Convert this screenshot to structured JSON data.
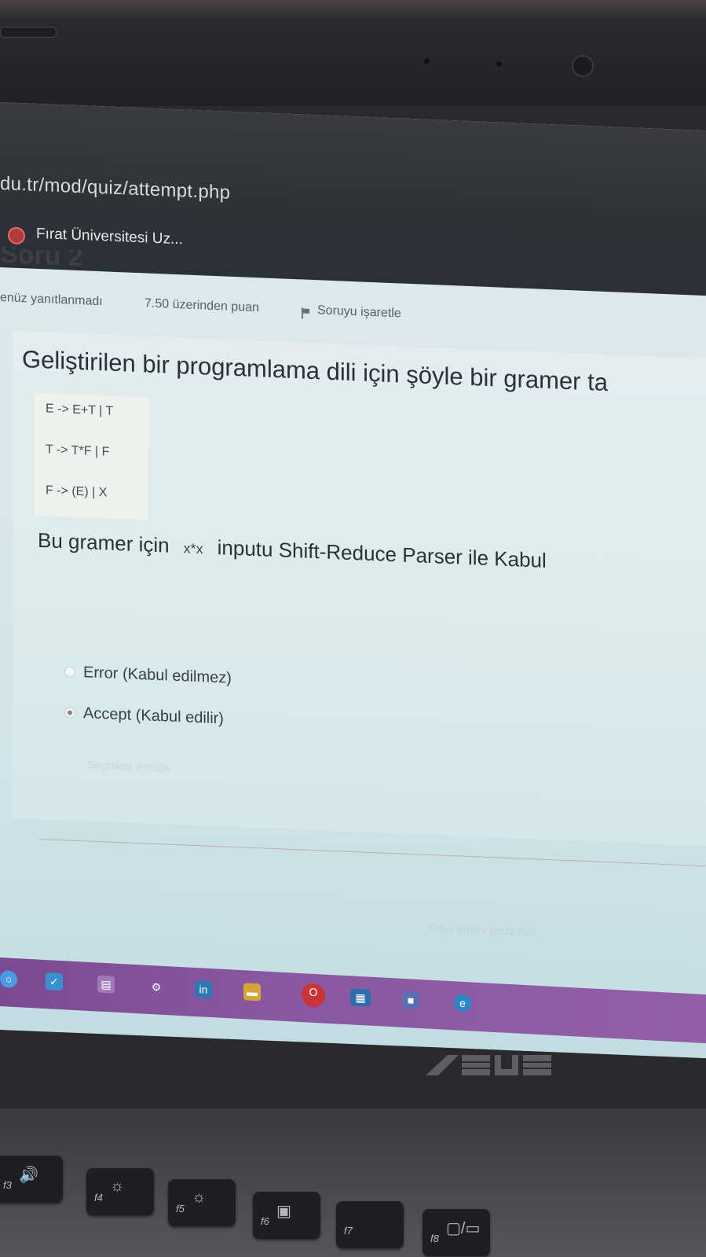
{
  "browser": {
    "url": "du.tr/mod/quiz/attempt.php",
    "tab_title": "Fırat Üniversitesi Uz..."
  },
  "question": {
    "heading_partial": "Soru 2",
    "status": "enüz yanıtlanmadı",
    "points": "7.50 üzerinden puan",
    "flag_label": "Soruyu işaretle",
    "text": "Geliştirilen bir programlama dili için şöyle bir gramer ta",
    "grammar": [
      "E -> E+T | T",
      "T -> T*F | F",
      "F -> (E) | X"
    ],
    "prompt_prefix": "Bu gramer için",
    "input": "x*x",
    "prompt_suffix": "inputu Shift-Reduce Parser ile Kabul",
    "options": [
      {
        "label": "Error (Kabul edilmez)",
        "selected": false
      },
      {
        "label": "Accept (Kabul edilir)",
        "selected": true
      }
    ],
    "clear_choice": "Seçimimi temizle"
  },
  "footer": {
    "nav_link": "Kısa sınav gezintisi"
  },
  "taskbar": {
    "icons": [
      "search-icon",
      "checkmark-icon",
      "files-icon",
      "settings-icon",
      "linkedin-icon",
      "folder-icon",
      "opera-icon",
      "store-icon",
      "app-icon",
      "edge-icon"
    ]
  },
  "laptop": {
    "brand": "ASUS"
  },
  "keyboard": {
    "keys": [
      {
        "label": "f3",
        "glyph": "🔊"
      },
      {
        "label": "f4",
        "glyph": "☼"
      },
      {
        "label": "f5",
        "glyph": "☼"
      },
      {
        "label": "f6",
        "glyph": "▣"
      },
      {
        "label": "f7",
        "glyph": ""
      },
      {
        "label": "f8",
        "glyph": "▢/▭"
      }
    ]
  },
  "colors": {
    "taskbar": "#8a58a2",
    "screen_bg": "#d9e8e9",
    "browser_bar": "#2f3135"
  }
}
